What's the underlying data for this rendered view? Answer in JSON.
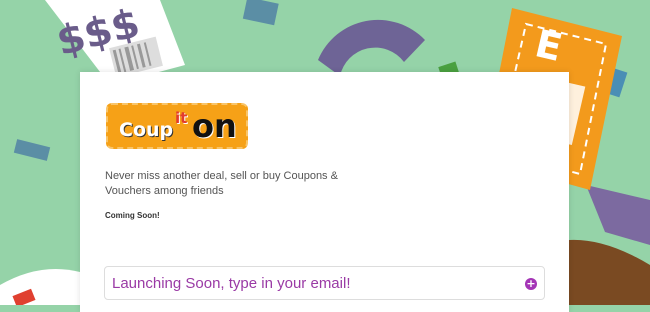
{
  "background": {
    "color": "#95d3a8",
    "receipt_text": "$$$",
    "voucher_text": "E"
  },
  "logo": {
    "part1": "Coup",
    "part2": "it",
    "part3": "on",
    "bg_color": "#f6a117"
  },
  "tagline": "Never miss another deal, sell or buy Coupons & Vouchers among friends",
  "status": "Coming Soon!",
  "signup": {
    "placeholder": "Launching Soon, type in your email!",
    "submit_icon": "plus-circle-icon",
    "accent": "#a435b6"
  }
}
